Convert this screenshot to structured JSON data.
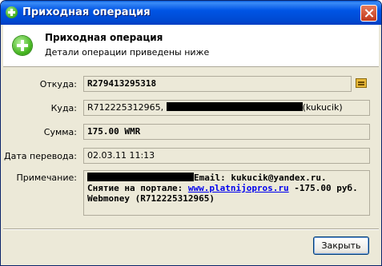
{
  "window": {
    "title": "Приходная операция"
  },
  "header": {
    "title": "Приходная операция",
    "subtitle": "Детали операции приведены ниже"
  },
  "fields": {
    "from_label": "Откуда:",
    "from_value": "R279413295318",
    "to_label": "Куда:",
    "to_value_prefix": "R712225312965,",
    "to_value_suffix": "(kukucik)",
    "amount_label": "Сумма:",
    "amount_value": "175.00 WMR",
    "date_label": "Дата перевода:",
    "date_value": "02.03.11 11:13",
    "note_label": "Примечание:",
    "note_line1": "Email: kukucik@yandex.ru.",
    "note_line2_prefix": "Снятие на портале: ",
    "note_link": "www.platnijopros.ru",
    "note_line2_suffix": " -175.00 руб.",
    "note_line3": "Webmoney (R712225312965)"
  },
  "buttons": {
    "close_label": "Закрыть"
  }
}
